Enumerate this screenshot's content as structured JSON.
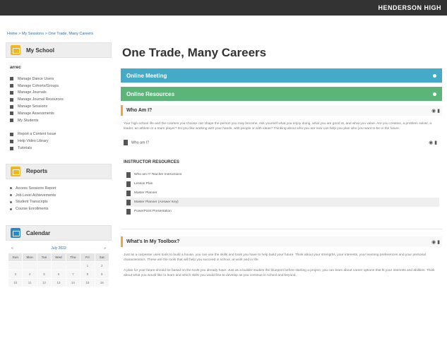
{
  "header": {
    "school": "HENDERSON HIGH"
  },
  "breadcrumb": "Home > My Sessions > One Trade, Many Careers",
  "sidebar": {
    "school_panel": {
      "title": "My School",
      "sub_title": "arrec",
      "items": [
        {
          "label": "Manage Dance Users"
        },
        {
          "label": "Manage Cohorts/Groups"
        },
        {
          "label": "Manage Journals"
        },
        {
          "label": "Manage Journal Resources"
        },
        {
          "label": "Manage Sessions"
        },
        {
          "label": "Manage Assessments"
        },
        {
          "label": "My Students"
        }
      ],
      "items2": [
        {
          "label": "Report a Content Issue"
        },
        {
          "label": "Help Video Library"
        },
        {
          "label": "Tutorials"
        }
      ]
    },
    "reports_panel": {
      "title": "Reports",
      "items": [
        {
          "label": "Access Sessions Report"
        },
        {
          "label": "Job Level Achievements"
        },
        {
          "label": "Student Transcripts"
        },
        {
          "label": "Course Enrollments"
        }
      ]
    },
    "calendar": {
      "title": "Calendar",
      "month": "July 2022",
      "prev": "«",
      "next": "»",
      "weekdays": [
        "Sun",
        "Mon",
        "Tue",
        "Wed",
        "Thu",
        "Fri",
        "Sat"
      ],
      "rows": [
        [
          "",
          "",
          "",
          "",
          "",
          "1",
          "2"
        ],
        [
          "3",
          "4",
          "5",
          "6",
          "7",
          "8",
          "9"
        ],
        [
          "10",
          "11",
          "12",
          "13",
          "14",
          "15",
          "16"
        ]
      ]
    }
  },
  "main": {
    "title": "One Trade, Many Careers",
    "bars": [
      {
        "label": "Online Meeting"
      },
      {
        "label": "Online Resources"
      }
    ],
    "who_am_i": {
      "title": "Who Am I?",
      "text": "Your high school life and the courses you choose can shape the person you may become. Ask yourself what you enjoy doing, what you are good at, and what you value. Are you creative, a problem solver, a leader, an athlete or a team player? Do you like working with your hands, with people or with ideas? Thinking about who you are now can help you plan who you want to be in the future.",
      "file": "Who am I?"
    },
    "instructor_resources": {
      "title": "INSTRUCTOR RESOURCES",
      "items": [
        {
          "label": "Who am I? Teacher Instructions"
        },
        {
          "label": "Lesson Plan"
        },
        {
          "label": "Master Planner"
        },
        {
          "label": "Master Planner (Answer Key)"
        },
        {
          "label": "PowerPoint Presentation"
        }
      ]
    },
    "toolbox": {
      "title": "What's In My Toolbox?",
      "text1": "Just as a carpenter uses tools to build a house, you can use the skills and tools you have to help build your future. Think about your strengths, your interests, your learning preferences and your personal characteristics. These are the tools that will help you succeed in school, at work and in life.",
      "text2": "A plan for your future should be based on the tools you already have. Just as a builder studies the blueprint before starting a project, you can learn about career options that fit your interests and abilities. Think about what you would like to learn and which skills you would like to develop as you continue in school and beyond."
    }
  }
}
